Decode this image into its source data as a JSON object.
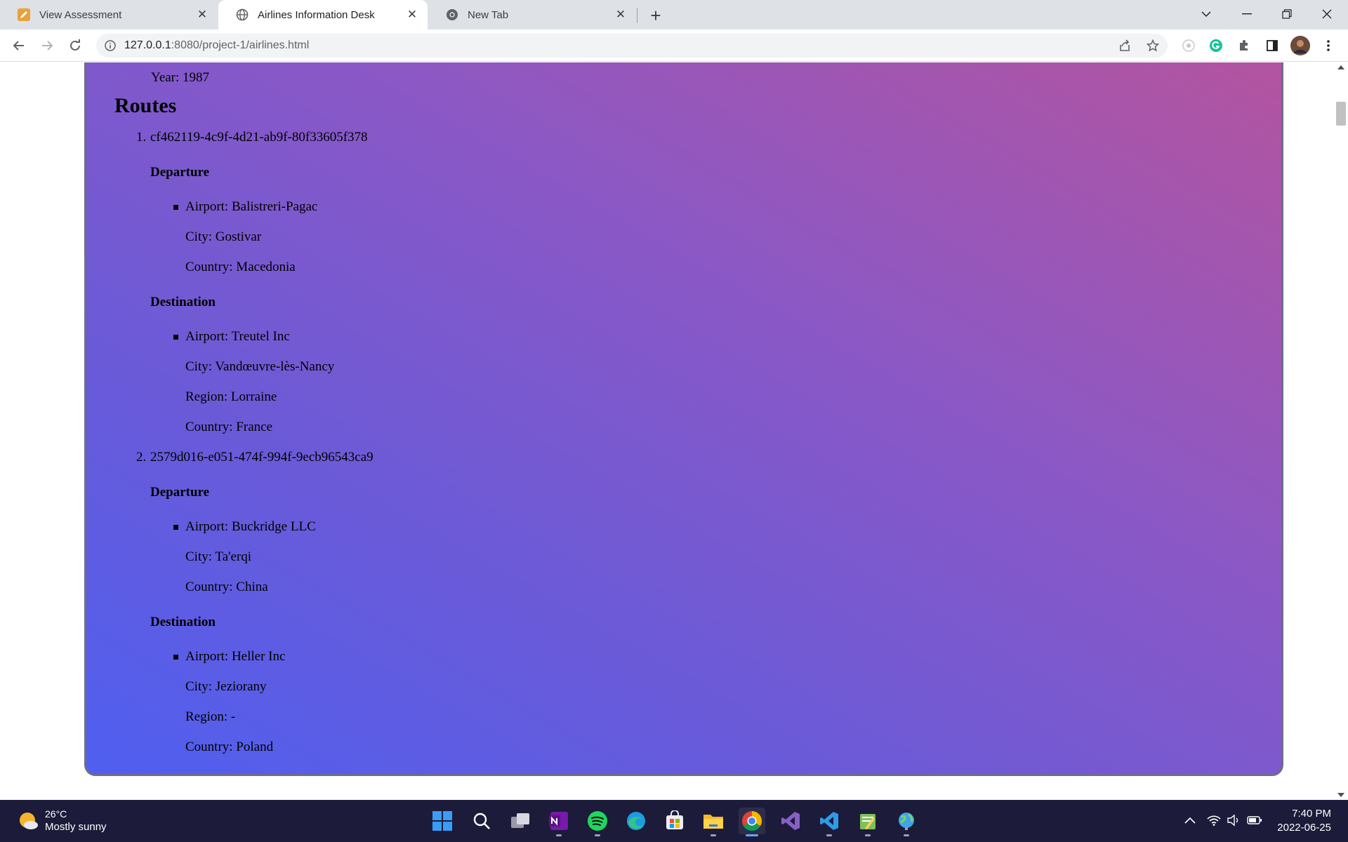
{
  "browser": {
    "tabs": [
      {
        "title": "View Assessment",
        "active": false,
        "icon": "edit-icon"
      },
      {
        "title": "Airlines Information Desk",
        "active": true,
        "icon": "globe-icon"
      },
      {
        "title": "New Tab",
        "active": false,
        "icon": "chrome-icon"
      }
    ],
    "url_host": "127.0.0.1",
    "url_rest": ":8080/project-1/airlines.html"
  },
  "page": {
    "year_line": "Year: 1987",
    "routes_heading": "Routes",
    "routes": [
      {
        "number": "1.",
        "id": "cf462119-4c9f-4d21-ab9f-80f33605f378",
        "departure": {
          "heading": "Departure",
          "airport": "Airport: Balistreri-Pagac",
          "city": "City: Gostivar",
          "country": "Country: Macedonia"
        },
        "destination": {
          "heading": "Destination",
          "airport": "Airport: Treutel Inc",
          "city": "City: Vandœuvre-lès-Nancy",
          "region": "Region: Lorraine",
          "country": "Country: France"
        }
      },
      {
        "number": "2.",
        "id": "2579d016-e051-474f-994f-9ecb96543ca9",
        "departure": {
          "heading": "Departure",
          "airport": "Airport: Buckridge LLC",
          "city": "City: Ta'erqi",
          "country": "Country: China"
        },
        "destination": {
          "heading": "Destination",
          "airport": "Airport: Heller Inc",
          "city": "City: Jeziorany",
          "region": "Region: -",
          "country": "Country: Poland"
        }
      }
    ]
  },
  "taskbar": {
    "weather_temp": "26°C",
    "weather_condition": "Mostly sunny",
    "time": "7:40 PM",
    "date": "2022-06-25",
    "apps": [
      "start",
      "search",
      "task-view",
      "onenote",
      "spotify",
      "edge",
      "store",
      "file-explorer",
      "chrome",
      "visual-studio",
      "vscode",
      "notepad",
      "network-app"
    ]
  },
  "colors": {
    "gradient_start": "#4f5ff0",
    "gradient_end": "#b5549e",
    "taskbar": "#1c1b3a",
    "tabstrip": "#dee1e6"
  }
}
